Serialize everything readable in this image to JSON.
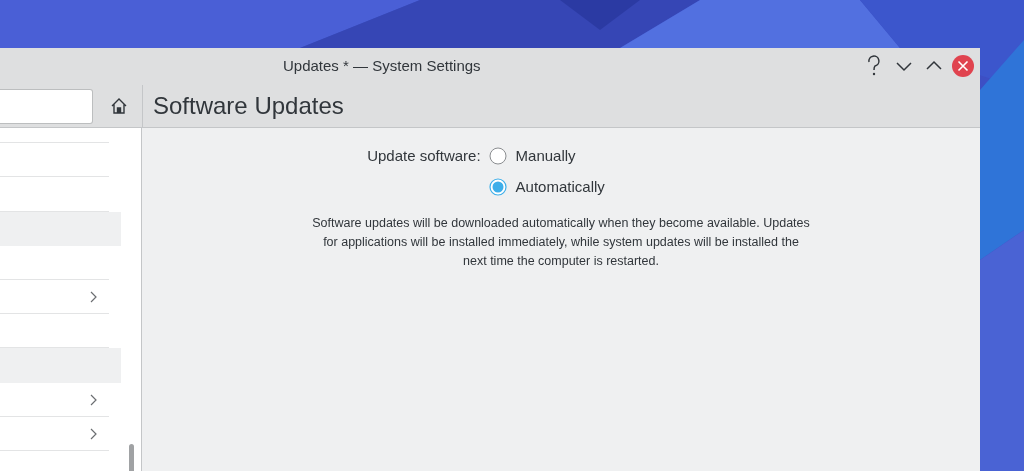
{
  "window": {
    "title": "Updates * — System Settings",
    "controls": [
      {
        "kind": "help"
      },
      {
        "kind": "minimize"
      },
      {
        "kind": "maximize"
      },
      {
        "kind": "close"
      }
    ]
  },
  "sidebar": {
    "items": [
      {
        "kind": "row",
        "expandable": false
      },
      {
        "kind": "row",
        "expandable": false
      },
      {
        "kind": "row",
        "expandable": false
      },
      {
        "kind": "header"
      },
      {
        "kind": "row",
        "expandable": false
      },
      {
        "kind": "row",
        "expandable": true
      },
      {
        "kind": "row",
        "expandable": false
      },
      {
        "kind": "header"
      },
      {
        "kind": "row",
        "expandable": true
      },
      {
        "kind": "row",
        "expandable": true
      }
    ]
  },
  "page": {
    "title": "Software Updates",
    "setting_label": "Update software:",
    "options": [
      {
        "label": "Manually",
        "selected": false
      },
      {
        "label": "Automatically",
        "selected": true
      }
    ],
    "description": "Software updates will be downloaded automatically when they become available. Updates for applications will be installed immediately, while system updates will be installed the next time the computer is restarted."
  }
}
